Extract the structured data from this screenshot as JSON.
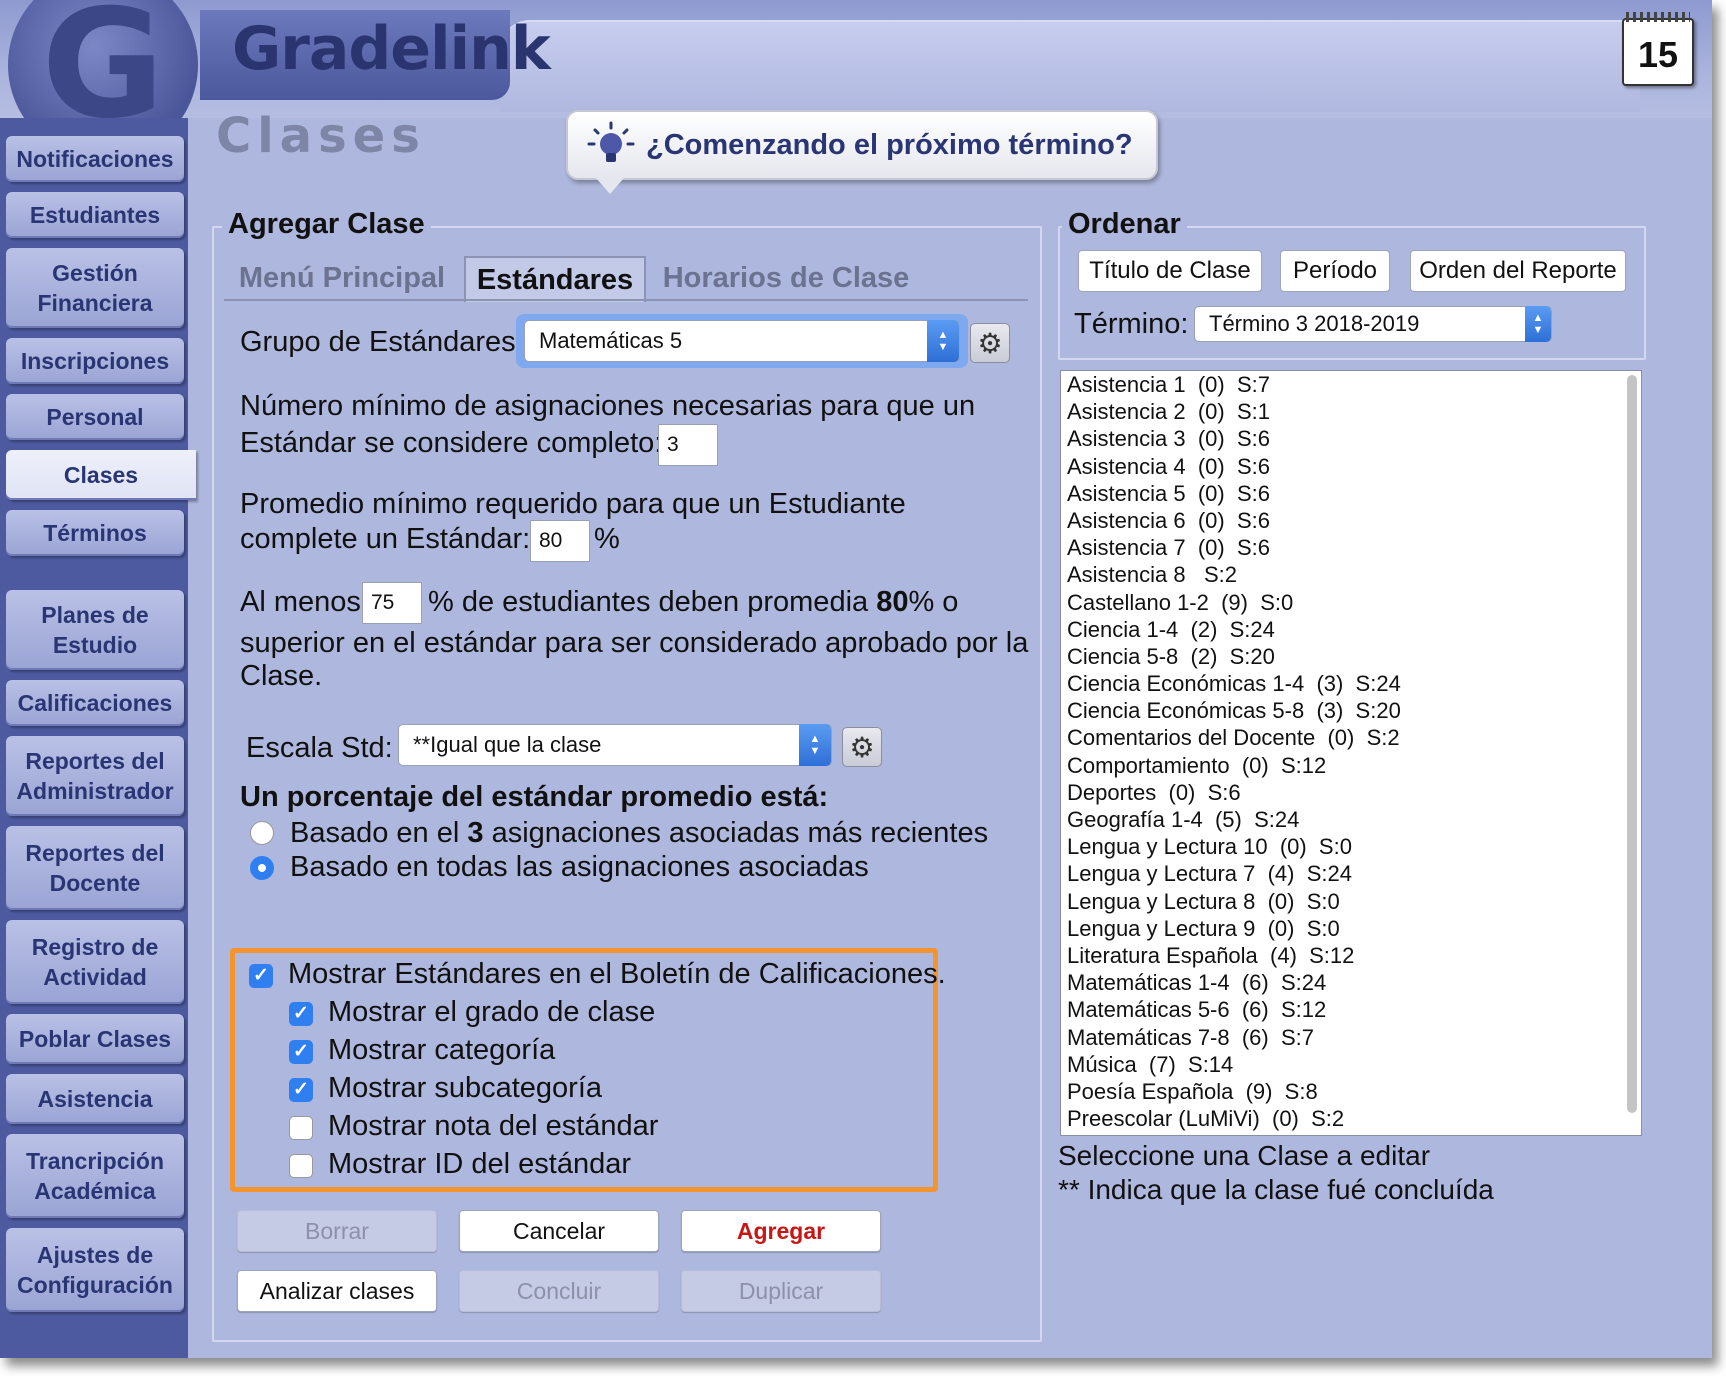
{
  "brand": {
    "name": "Gradelink",
    "logo_letter": "G",
    "calendar_day": "15"
  },
  "sidebar": {
    "items": [
      {
        "label": "Notificaciones"
      },
      {
        "label": "Estudiantes"
      },
      {
        "label": "Gestión\nFinanciera"
      },
      {
        "label": "Inscripciones"
      },
      {
        "label": "Personal"
      },
      {
        "label": "Clases",
        "active": true
      },
      {
        "label": "Términos"
      },
      {
        "label": "Planes de\nEstudio"
      },
      {
        "label": "Calificaciones"
      },
      {
        "label": "Reportes del\nAdministrador"
      },
      {
        "label": "Reportes del\nDocente"
      },
      {
        "label": "Registro de\nActividad"
      },
      {
        "label": "Poblar Clases"
      },
      {
        "label": "Asistencia"
      },
      {
        "label": "Trancripción\nAcadémica"
      },
      {
        "label": "Ajustes de\nConfiguración"
      }
    ]
  },
  "page": {
    "title": "Clases",
    "hint": "¿Comenzando el próximo término?"
  },
  "add_class": {
    "legend": "Agregar Clase",
    "tabs": [
      "Menú Principal",
      "Estándares",
      "Horarios de Clase"
    ],
    "active_tab": "Estándares",
    "group_label": "Grupo de Estándares:",
    "group_value": "Matemáticas 5",
    "min_assign_text_1": "Número mínimo de asignaciones necesarias para que un",
    "min_assign_text_2": "Estándar se considere completo:",
    "min_assign_value": "3",
    "min_avg_text_1": "Promedio mínimo requerido para que un Estudiante",
    "min_avg_text_2": "complete un Estándar:",
    "min_avg_value": "80",
    "percent_sign": "%",
    "at_least_prefix": "Al menos",
    "at_least_value": "75",
    "at_least_mid": "% de estudiantes deben promedia",
    "at_least_bold": "80",
    "at_least_suffix": "% o",
    "at_least_line2": "superior en el estándar para ser considerado aprobado por la",
    "at_least_line3": "Clase.",
    "scale_label": "Escala Std:",
    "scale_value": "**Igual que la clase",
    "avg_heading": "Un porcentaje del estándar promedio está:",
    "radio_recent_prefix": "Basado en el",
    "radio_recent_bold": "3",
    "radio_recent_suffix": "asignaciones asociadas más recientes",
    "radio_all": "Basado en todas las asignaciones asociadas",
    "radio_selected": "all",
    "options": [
      {
        "label": "Mostrar Estándares en el Boletín de Calificaciones.",
        "checked": true
      },
      {
        "label": "Mostrar el grado de clase",
        "checked": true
      },
      {
        "label": "Mostrar categoría",
        "checked": true
      },
      {
        "label": "Mostrar subcategoría",
        "checked": true
      },
      {
        "label": "Mostrar nota del estándar",
        "checked": false
      },
      {
        "label": "Mostrar ID del estándar",
        "checked": false
      }
    ],
    "buttons": {
      "borrar": "Borrar",
      "cancelar": "Cancelar",
      "agregar": "Agregar",
      "analizar": "Analizar clases",
      "concluir": "Concluir",
      "duplicar": "Duplicar"
    }
  },
  "sort": {
    "legend": "Ordenar",
    "buttons": [
      "Título de Clase",
      "Período",
      "Orden del Reporte"
    ],
    "term_label": "Término:",
    "term_value": "Término 3 2018-2019",
    "classes": [
      "Asistencia 1  (0)  S:7",
      "Asistencia 2  (0)  S:1",
      "Asistencia 3  (0)  S:6",
      "Asistencia 4  (0)  S:6",
      "Asistencia 5  (0)  S:6",
      "Asistencia 6  (0)  S:6",
      "Asistencia 7  (0)  S:6",
      "Asistencia 8   S:2",
      "Castellano 1-2  (9)  S:0",
      "Ciencia 1-4  (2)  S:24",
      "Ciencia 5-8  (2)  S:20",
      "Ciencia Económicas 1-4  (3)  S:24",
      "Ciencia Económicas 5-8  (3)  S:20",
      "Comentarios del Docente  (0)  S:2",
      "Comportamiento  (0)  S:12",
      "Deportes  (0)  S:6",
      "Geografía 1-4  (5)  S:24",
      "Lengua y Lectura 10  (0)  S:0",
      "Lengua y Lectura 7  (4)  S:24",
      "Lengua y Lectura 8  (0)  S:0",
      "Lengua y Lectura 9  (0)  S:0",
      "Literatura Española  (4)  S:12",
      "Matemáticas 1-4  (6)  S:24",
      "Matemáticas 5-6  (6)  S:12",
      "Matemáticas 7-8  (6)  S:7",
      "Música  (7)  S:14",
      "Poesía Española  (9)  S:8",
      "Preescolar (LuMiVi)  (0)  S:2"
    ],
    "help_1": "Seleccione una Clase a editar",
    "help_2": "** Indica que la clase fué concluída"
  }
}
